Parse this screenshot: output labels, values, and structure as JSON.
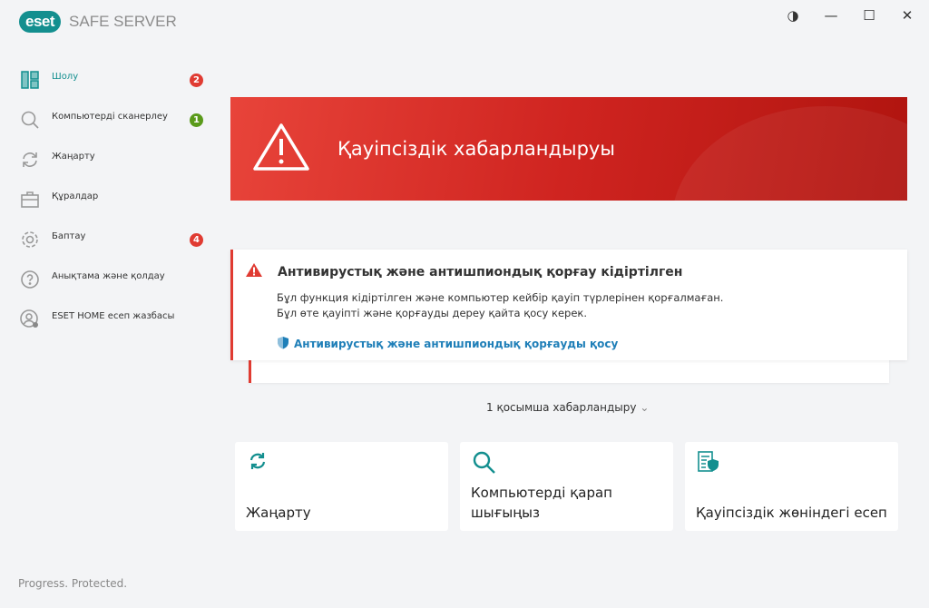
{
  "app": {
    "logo": "eset",
    "product": "SAFE SERVER",
    "tagline": "Progress. Protected."
  },
  "window": {
    "contrast": "◑",
    "minimize": "—",
    "maximize": "☐",
    "close": "✕"
  },
  "sidebar": {
    "items": [
      {
        "label": "Шолу",
        "badge": "2",
        "badge_color": "#e03b32",
        "icon": "dashboard-icon"
      },
      {
        "label": "Компьютерді сканерлеу",
        "badge": "1",
        "badge_color": "#5a9a1a",
        "icon": "search-icon"
      },
      {
        "label": "Жаңарту",
        "icon": "refresh-icon"
      },
      {
        "label": "Құралдар",
        "icon": "toolbox-icon"
      },
      {
        "label": "Баптау",
        "badge": "4",
        "badge_color": "#e03b32",
        "icon": "gear-icon"
      },
      {
        "label": "Анықтама және қолдау",
        "icon": "help-icon"
      },
      {
        "label": "ESET HOME есеп жазбасы",
        "icon": "account-icon"
      }
    ]
  },
  "banner": {
    "title": "Қауіпсіздік хабарландыруы"
  },
  "alert": {
    "title": "Антивирустық және антишпиондық қорғау кідіртілген",
    "line1": "Бұл функция кідіртілген және компьютер кейбір қауіп түрлерінен қорғалмаған.",
    "line2": "Бұл өте қауіпті және қорғауды дереу қайта қосу керек.",
    "link": "Антивирустық және антишпиондық қорғауды қосу"
  },
  "more_notifications": "1 қосымша хабарландыру",
  "tiles": [
    {
      "label": "Жаңарту"
    },
    {
      "label": "Компьютерді қарап шығыңыз"
    },
    {
      "label": "Қауіпсіздік жөніндегі есеп"
    }
  ]
}
